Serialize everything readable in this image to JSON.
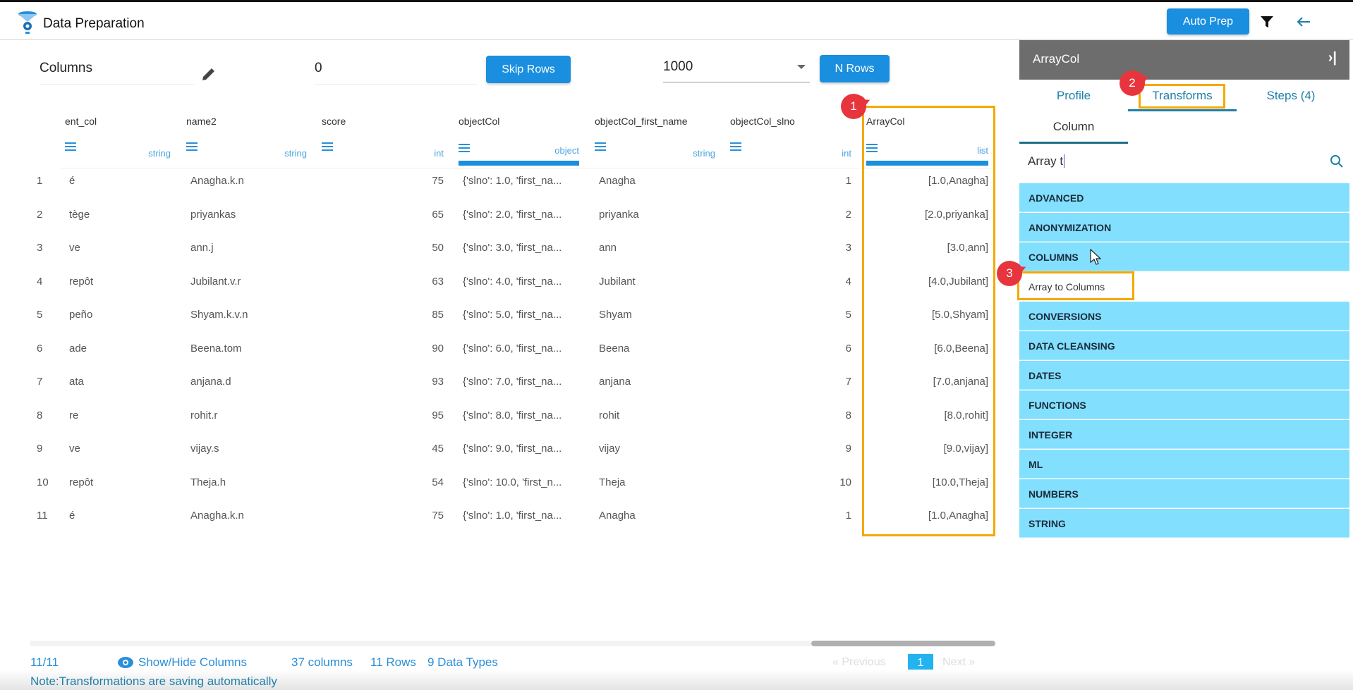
{
  "app": {
    "title": "Data Preparation",
    "auto_prep": "Auto Prep",
    "icons": [
      "filter-icon",
      "back-arrow-icon"
    ]
  },
  "toolbar": {
    "columns_value": "Columns",
    "skip_value": "0",
    "skip_button": "Skip Rows",
    "nrows_value": "1000",
    "nrows_button": "N Rows"
  },
  "table": {
    "columns": [
      {
        "name": "ent_col",
        "type": "string"
      },
      {
        "name": "name2",
        "type": "string"
      },
      {
        "name": "score",
        "type": "int"
      },
      {
        "name": "objectCol",
        "type": "object"
      },
      {
        "name": "objectCol_first_name",
        "type": "string"
      },
      {
        "name": "objectCol_slno",
        "type": "int"
      },
      {
        "name": "ArrayCol",
        "type": "list"
      }
    ],
    "rows": [
      [
        "1",
        "é",
        "Anagha.k.n",
        "75",
        "{'slno': 1.0, 'first_na...",
        "Anagha",
        "1",
        "[1.0,Anagha]"
      ],
      [
        "2",
        "tège",
        "priyankas",
        "65",
        "{'slno': 2.0, 'first_na...",
        "priyanka",
        "2",
        "[2.0,priyanka]"
      ],
      [
        "3",
        "ve",
        "ann.j",
        "50",
        "{'slno': 3.0, 'first_na...",
        "ann",
        "3",
        "[3.0,ann]"
      ],
      [
        "4",
        "repôt",
        "Jubilant.v.r",
        "63",
        "{'slno': 4.0, 'first_na...",
        "Jubilant",
        "4",
        "[4.0,Jubilant]"
      ],
      [
        "5",
        "peño",
        "Shyam.k.v.n",
        "85",
        "{'slno': 5.0, 'first_na...",
        "Shyam",
        "5",
        "[5.0,Shyam]"
      ],
      [
        "6",
        "ade",
        "Beena.tom",
        "90",
        "{'slno': 6.0, 'first_na...",
        "Beena",
        "6",
        "[6.0,Beena]"
      ],
      [
        "7",
        "ata",
        "anjana.d",
        "93",
        "{'slno': 7.0, 'first_na...",
        "anjana",
        "7",
        "[7.0,anjana]"
      ],
      [
        "8",
        "re",
        "rohit.r",
        "95",
        "{'slno': 8.0, 'first_na...",
        "rohit",
        "8",
        "[8.0,rohit]"
      ],
      [
        "9",
        "ve",
        "vijay.s",
        "45",
        "{'slno': 9.0, 'first_na...",
        "vijay",
        "9",
        "[9.0,vijay]"
      ],
      [
        "10",
        "repôt",
        "Theja.h",
        "54",
        "{'slno': 10.0, 'first_n...",
        "Theja",
        "10",
        "[10.0,Theja]"
      ],
      [
        "11",
        "é",
        "Anagha.k.n",
        "75",
        "{'slno': 1.0, 'first_na...",
        "Anagha",
        "1",
        "[1.0,Anagha]"
      ]
    ]
  },
  "footer": {
    "count": "11/11",
    "show_hide": "Show/Hide Columns",
    "columns": "37 columns",
    "rows": "11 Rows",
    "types": "9 Data Types",
    "previous": "Previous",
    "page": "1",
    "next": "Next",
    "note": "Note:Transformations are saving automatically"
  },
  "panel": {
    "title": "ArrayCol",
    "tabs": [
      "Profile",
      "Transforms",
      "Steps (4)"
    ],
    "active_tab": "Transforms",
    "subtab": "Column",
    "search_value": "Array t",
    "categories": [
      "ADVANCED",
      "ANONYMIZATION",
      "COLUMNS",
      "Array to Columns",
      "CONVERSIONS",
      "DATA CLEANSING",
      "DATES",
      "FUNCTIONS",
      "INTEGER",
      "ML",
      "NUMBERS",
      "STRING"
    ],
    "category_color": "#82dffd"
  },
  "annotations": [
    "1",
    "2",
    "3"
  ],
  "colors": {
    "accent": "#1a8fdf",
    "highlight": "#f5a800",
    "badge": "#e8353d"
  }
}
